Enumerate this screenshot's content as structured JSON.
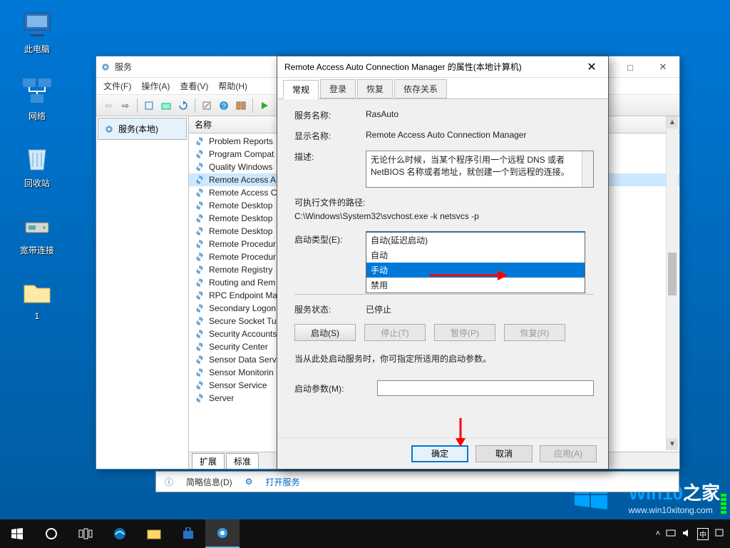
{
  "desktop": {
    "icons": [
      "此电脑",
      "网络",
      "回收站",
      "宽带连接",
      "1"
    ]
  },
  "backwin": {
    "label1": "简略信息(D)",
    "label2": "打开服务"
  },
  "services_window": {
    "title": "服务",
    "menu": [
      "文件(F)",
      "操作(A)",
      "查看(V)",
      "帮助(H)"
    ],
    "tree_node": "服务(本地)",
    "column_header": "名称",
    "tabs": [
      "扩展",
      "标准"
    ],
    "items": [
      "Problem Reports",
      "Program Compat",
      "Quality Windows",
      "Remote Access A",
      "Remote Access C",
      "Remote Desktop",
      "Remote Desktop",
      "Remote Desktop",
      "Remote Procedur",
      "Remote Procedur",
      "Remote Registry",
      "Routing and Rem",
      "RPC Endpoint Ma",
      "Secondary Logon",
      "Secure Socket Tu",
      "Security Accounts",
      "Security Center",
      "Sensor Data Serv",
      "Sensor Monitorin",
      "Sensor Service",
      "Server"
    ],
    "selected_index": 3,
    "win_buttons": {
      "min": "—",
      "max": "□",
      "close": "✕"
    }
  },
  "properties": {
    "title": "Remote Access Auto Connection Manager 的属性(本地计算机)",
    "tabs": [
      "常规",
      "登录",
      "恢复",
      "依存关系"
    ],
    "labels": {
      "service_name": "服务名称:",
      "display_name": "显示名称:",
      "description": "描述:",
      "exe_path": "可执行文件的路径:",
      "startup_type": "启动类型(E):",
      "status": "服务状态:",
      "hint": "当从此处启动服务时，你可指定所适用的启动参数。",
      "start_params": "启动参数(M):"
    },
    "values": {
      "service_name": "RasAuto",
      "display_name": "Remote Access Auto Connection Manager",
      "description": "无论什么时候，当某个程序引用一个远程 DNS 或者 NetBIOS 名称或者地址，就创建一个到远程的连接。",
      "exe_path": "C:\\Windows\\System32\\svchost.exe -k netsvcs -p",
      "startup_selected": "手动",
      "status": "已停止"
    },
    "dropdown_options": [
      "自动(延迟启动)",
      "自动",
      "手动",
      "禁用"
    ],
    "dropdown_highlight": 2,
    "buttons": {
      "start": "启动(S)",
      "stop": "停止(T)",
      "pause": "暂停(P)",
      "resume": "恢复(R)"
    },
    "footer": {
      "ok": "确定",
      "cancel": "取消",
      "apply": "应用(A)"
    }
  },
  "watermark": {
    "brand1": "Win10",
    "brand2": "之家",
    "url": "www.win10xitong.com"
  },
  "tray": {
    "time": ""
  }
}
